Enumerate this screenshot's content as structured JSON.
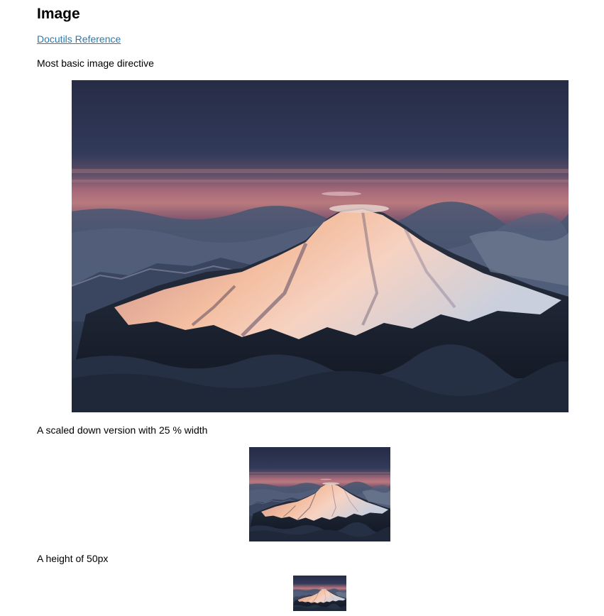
{
  "page": {
    "title": "Image",
    "reference_link": "Docutils Reference"
  },
  "sections": [
    {
      "caption": "Most basic image directive",
      "image_alt": "Aerial view of a snow-capped volcanic mountain above clouds at sunset"
    },
    {
      "caption": "A scaled down version with 25 % width",
      "image_alt": "Aerial view of a snow-capped volcanic mountain above clouds at sunset"
    },
    {
      "caption": "A height of 50px",
      "image_alt": "Aerial view of a snow-capped volcanic mountain above clouds at sunset"
    }
  ],
  "colors": {
    "link": "#2a7ab0",
    "sky_top": "#2b3350",
    "sunset_band": "#b0707a",
    "snow_lit": "#f2b89a",
    "clouds": "#2e3a4e"
  }
}
